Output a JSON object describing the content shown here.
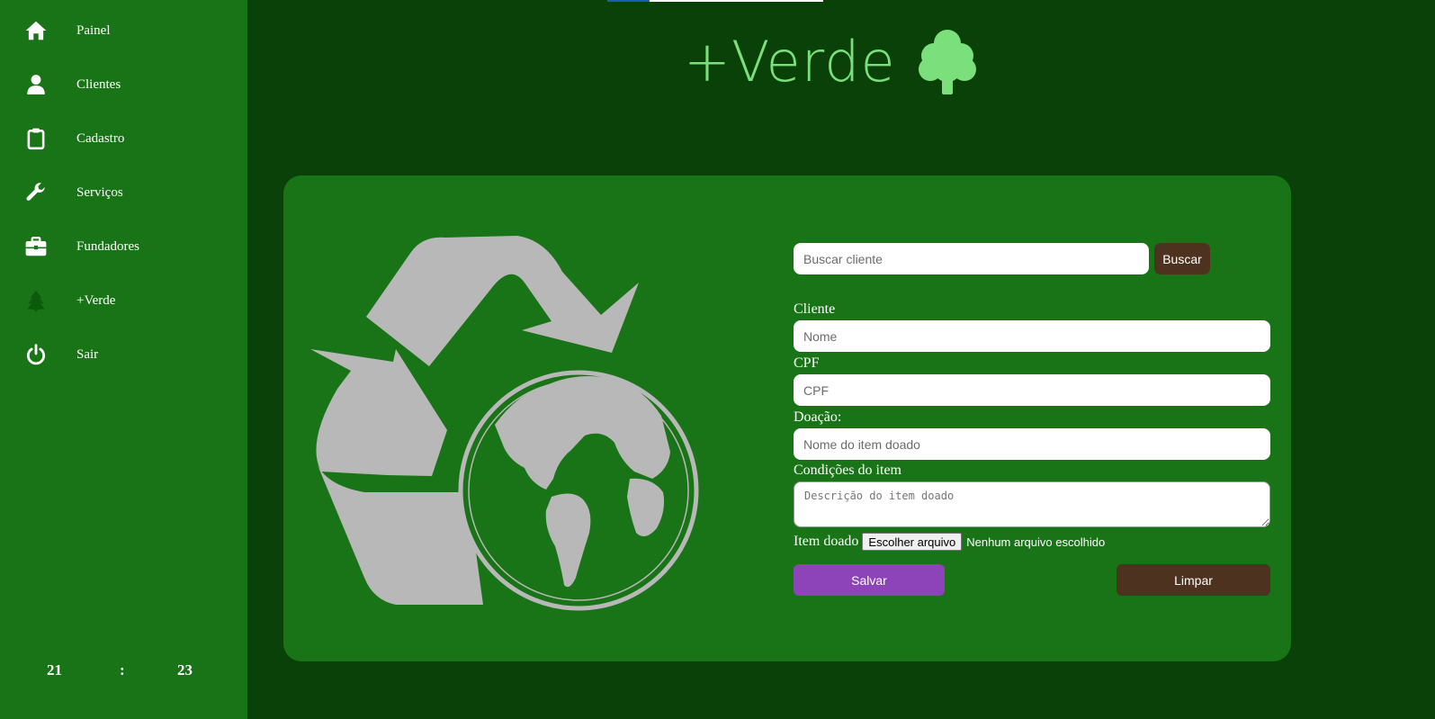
{
  "sidebar": {
    "items": [
      {
        "label": "Painel",
        "icon": "home-icon"
      },
      {
        "label": "Clientes",
        "icon": "user-icon"
      },
      {
        "label": "Cadastro",
        "icon": "clipboard-icon"
      },
      {
        "label": "Serviços",
        "icon": "wrench-icon"
      },
      {
        "label": "Fundadores",
        "icon": "briefcase-icon"
      },
      {
        "label": "+Verde",
        "icon": "tree-icon"
      },
      {
        "label": "Sair",
        "icon": "power-icon"
      }
    ],
    "clock": {
      "hours": "21",
      "separator": ":",
      "minutes": "23"
    }
  },
  "header": {
    "brand": "+Verde",
    "brand_icon": "tree-icon"
  },
  "search": {
    "placeholder": "Buscar cliente",
    "button_label": "Buscar"
  },
  "form": {
    "client_label": "Cliente",
    "name_placeholder": "Nome",
    "cpf_label": "CPF",
    "cpf_placeholder": "CPF",
    "donation_label": "Doação:",
    "donation_placeholder": "Nome do item doado",
    "conditions_label": "Condições do item",
    "conditions_placeholder": "Descrição do item doado",
    "file_label": "Item doado",
    "file_button": "Escolher arquivo",
    "file_status": "Nenhum arquivo escolhido",
    "save_label": "Salvar",
    "clear_label": "Limpar"
  },
  "colors": {
    "page_bg": "#0a4108",
    "sidebar_bg": "#197417",
    "card_bg": "#197417",
    "brand_text": "#7be07b",
    "save_button": "#8c44b8",
    "brown_button": "#4d3220",
    "illustration": "#b8b8b8"
  }
}
